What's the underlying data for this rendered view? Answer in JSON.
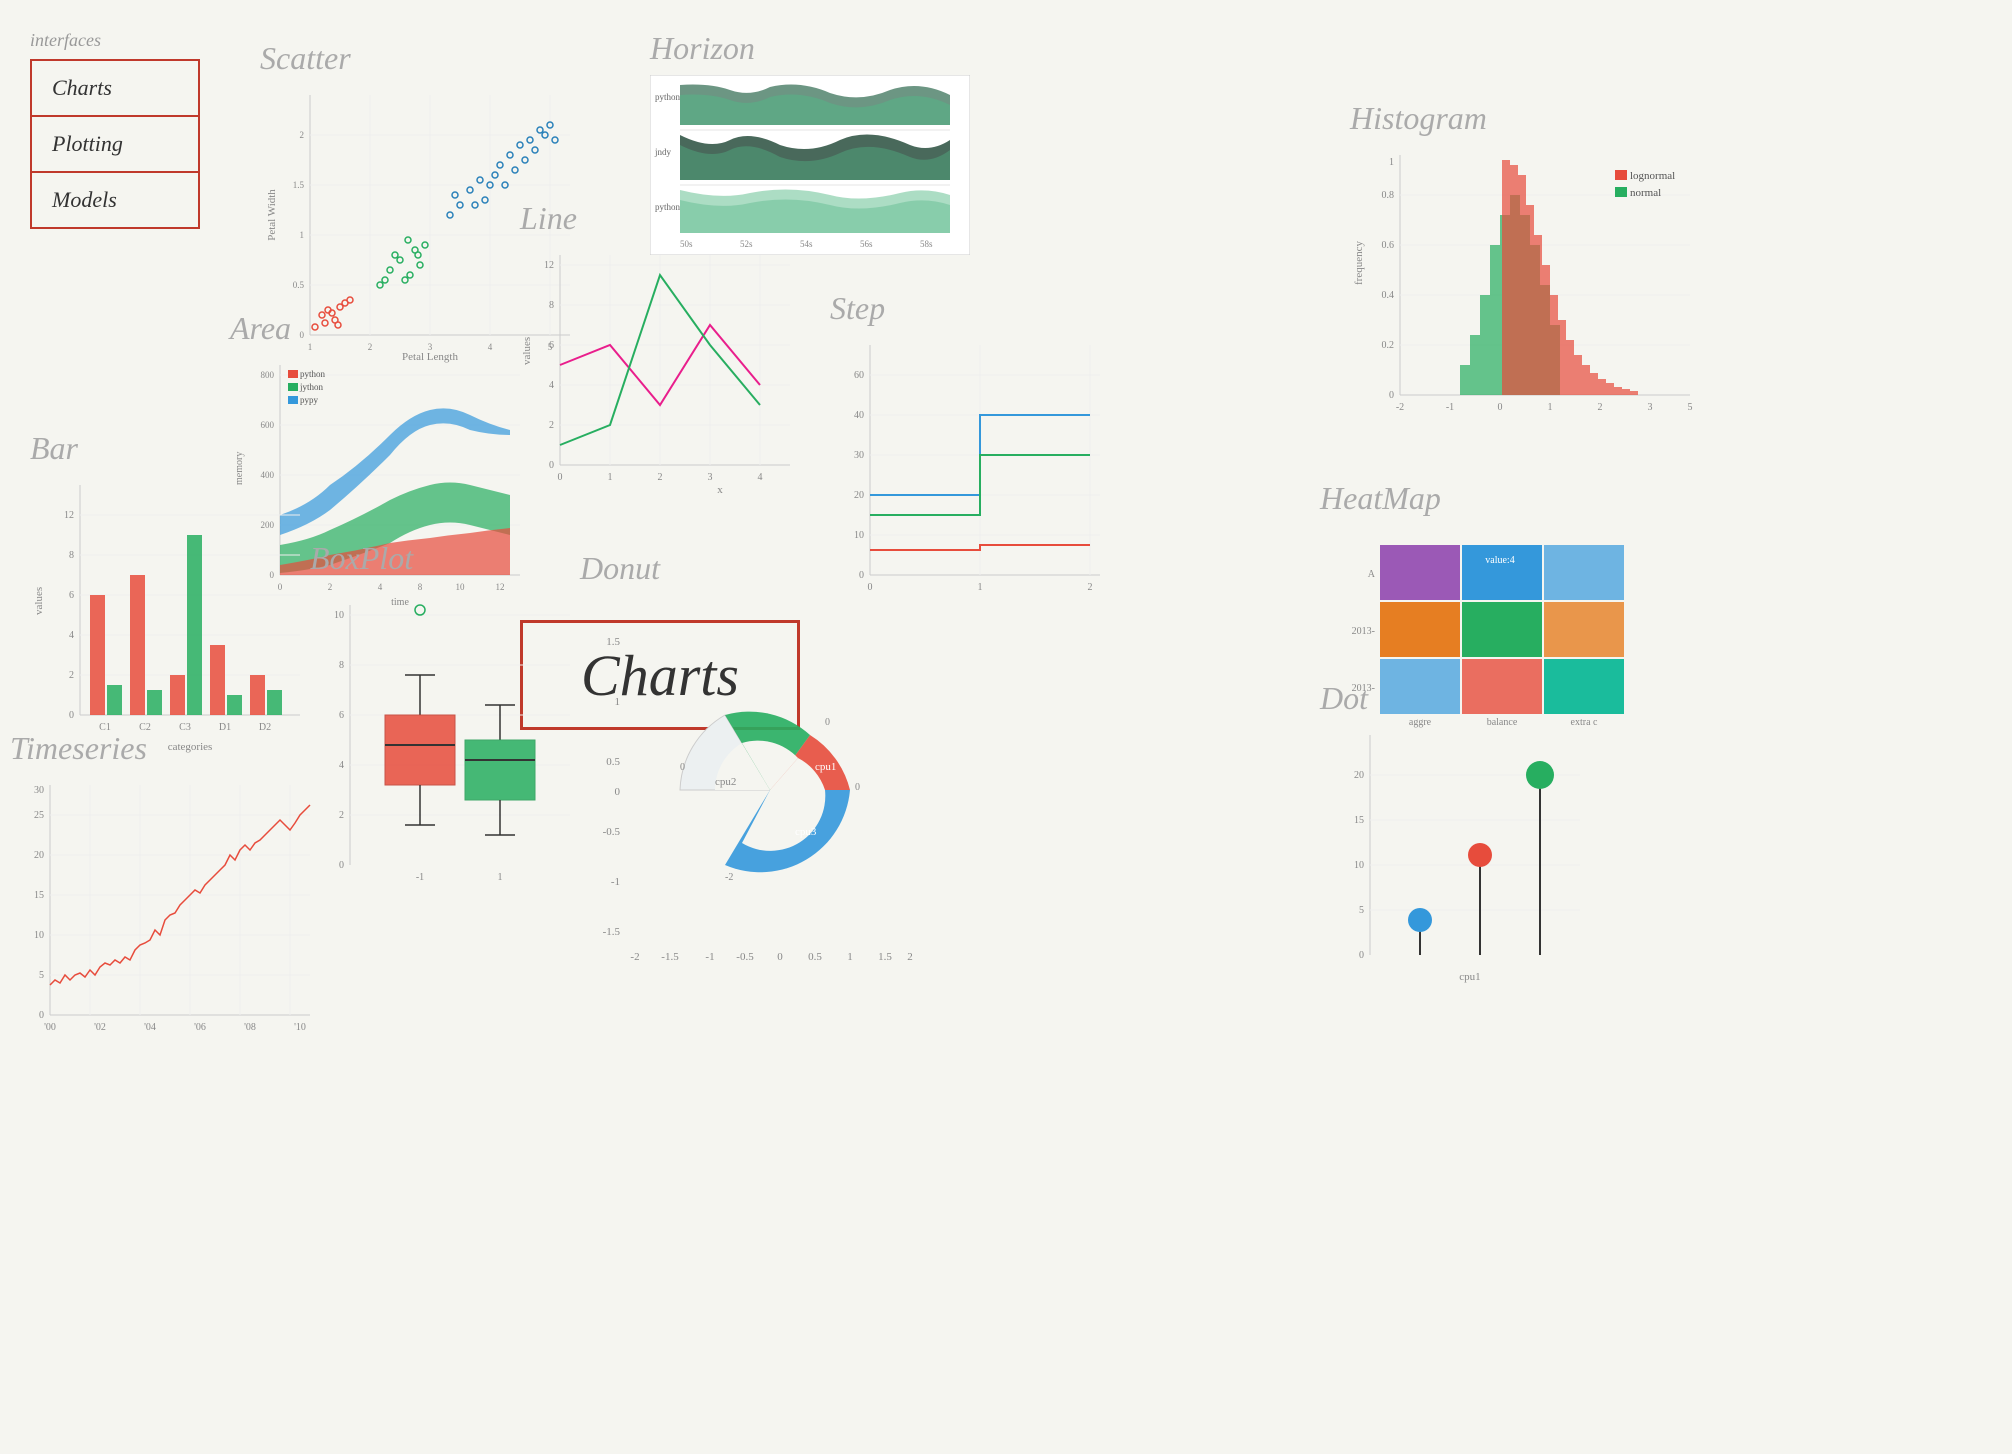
{
  "sidebar": {
    "interfaces_label": "interfaces",
    "items": [
      "Charts",
      "Plotting",
      "Models"
    ]
  },
  "charts_label": "Charts",
  "chart_titles": {
    "scatter": "Scatter",
    "horizon": "Horizon",
    "histogram": "Histogram",
    "line": "Line",
    "area": "Area",
    "step": "Step",
    "bar": "Bar",
    "boxplot": "BoxPlot",
    "heatmap": "HeatMap",
    "donut": "Donut",
    "dot": "Dot",
    "timeseries": "Timeseries"
  }
}
